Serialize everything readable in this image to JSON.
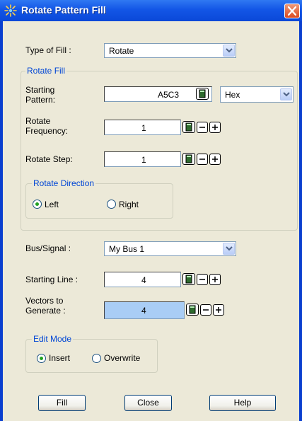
{
  "dialog": {
    "title": "Rotate Pattern Fill"
  },
  "type_of_fill": {
    "label": "Type of Fill :",
    "value": "Rotate"
  },
  "rotate_fill": {
    "group_title": "Rotate Fill",
    "starting_pattern": {
      "label_line1": "Starting",
      "label_line2": "Pattern:",
      "value": "A5C3",
      "base": "Hex"
    },
    "rotate_frequency": {
      "label_line1": "Rotate",
      "label_line2": "Frequency:",
      "value": "1"
    },
    "rotate_step": {
      "label": "Rotate Step:",
      "value": "1"
    },
    "rotate_direction": {
      "group_title": "Rotate Direction",
      "options": [
        {
          "label": "Left",
          "selected": true
        },
        {
          "label": "Right",
          "selected": false
        }
      ]
    }
  },
  "bus_signal": {
    "label": "Bus/Signal :",
    "value": "My Bus 1"
  },
  "starting_line": {
    "label": "Starting Line :",
    "value": "4"
  },
  "vectors_to_generate": {
    "label_line1": "Vectors to",
    "label_line2": "Generate :",
    "value": "4"
  },
  "edit_mode": {
    "group_title": "Edit Mode",
    "options": [
      {
        "label": "Insert",
        "selected": true
      },
      {
        "label": "Overwrite",
        "selected": false
      }
    ]
  },
  "buttons": {
    "fill": "Fill",
    "close": "Close",
    "help": "Help"
  },
  "colors": {
    "title_bar": "#1356e6",
    "group_title": "#0046d5",
    "selection": "#a9cdf5",
    "radio_dot": "#21a121"
  }
}
